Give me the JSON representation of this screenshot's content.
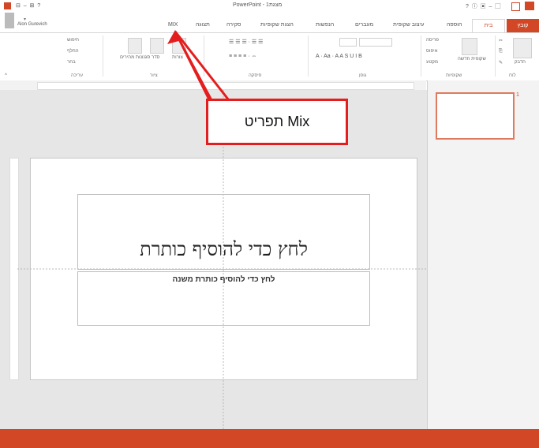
{
  "window": {
    "title": "PowerPoint - מצגת1",
    "user": "Alon Gurevich"
  },
  "tabs": [
    {
      "label": "קובץ"
    },
    {
      "label": "בית"
    },
    {
      "label": "הוספה"
    },
    {
      "label": "עיצוב שקופית"
    },
    {
      "label": "מעברים"
    },
    {
      "label": "הנפשות"
    },
    {
      "label": "הצגת שקופיות"
    },
    {
      "label": "סקירה"
    },
    {
      "label": "תצוגה"
    },
    {
      "label": "MIX"
    }
  ],
  "ribbon": {
    "groups": [
      {
        "label": "לוח"
      },
      {
        "label": "שקופיות"
      },
      {
        "label": "גופן"
      },
      {
        "label": "פיסקה"
      },
      {
        "label": "ציור"
      },
      {
        "label": "עריכה"
      }
    ],
    "buttons": {
      "paste": "הדבק",
      "new_slide": "שקופית חדשה",
      "layout": "פריסה",
      "reset": "איפוס",
      "section": "מקטע",
      "shapes": "צורות",
      "arrange": "סדר",
      "quick_styles": "סגנונות מהירים",
      "find": "חיפוש",
      "replace": "החלף",
      "select": "בחר"
    }
  },
  "slide": {
    "title_placeholder": "לחץ כדי להוסיף כותרת",
    "subtitle_placeholder": "לחץ כדי להוסיף כותרת משנה"
  },
  "thumbnail": {
    "number": "1"
  },
  "callout": {
    "text": "תפריט Mix"
  },
  "colors": {
    "accent": "#d24726",
    "callout_border": "#e41e1e"
  }
}
